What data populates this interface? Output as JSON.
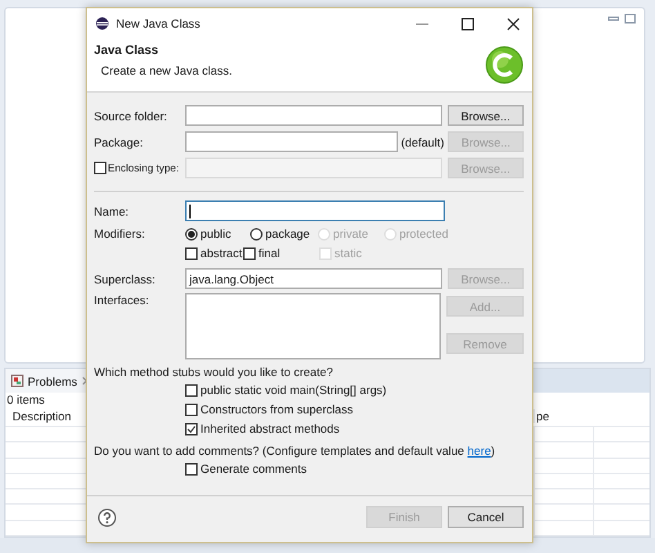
{
  "ide": {
    "problems": {
      "tab": "Problems",
      "status": "0 items",
      "columns": [
        "Description",
        "pe"
      ]
    }
  },
  "dialog": {
    "title": "New Java Class",
    "heading": "Java Class",
    "message": "Create a new Java class.",
    "location": [
      {
        "kind": "field",
        "label": "Source folder:",
        "button": {
          "label": "Browse...",
          "disabled": false
        }
      },
      {
        "kind": "suffixed",
        "label": "Package:",
        "suffix": "(default)",
        "button": {
          "label": "Browse...",
          "disabled": true
        }
      },
      {
        "kind": "checkfield",
        "label": "Enclosing type:",
        "checked": false,
        "disabled": true,
        "button": {
          "label": "Browse...",
          "disabled": true
        }
      }
    ],
    "name": {
      "label": "Name:",
      "focused": true
    },
    "modifiers": {
      "label": "Modifiers:",
      "radios": [
        {
          "label": "public",
          "selected": true,
          "disabled": false
        },
        {
          "label": "package",
          "selected": false,
          "disabled": false
        },
        {
          "label": "private",
          "selected": false,
          "disabled": true
        },
        {
          "label": "protected",
          "selected": false,
          "disabled": true
        }
      ],
      "checkboxes": [
        {
          "label": "abstract",
          "checked": false,
          "disabled": false
        },
        {
          "label": "final",
          "checked": false,
          "disabled": false
        },
        {
          "label": "static",
          "checked": false,
          "disabled": true
        }
      ]
    },
    "superclass": {
      "label": "Superclass:",
      "value": "java.lang.Object",
      "button": {
        "label": "Browse...",
        "disabled": true
      }
    },
    "interfaces": {
      "label": "Interfaces:",
      "buttons": [
        {
          "label": "Add...",
          "disabled": true
        },
        {
          "label": "Remove",
          "disabled": true
        }
      ]
    },
    "stubs": {
      "question": "Which method stubs would you like to create?",
      "options": [
        {
          "label": "public static void main(String[] args)",
          "checked": false
        },
        {
          "label": "Constructors from superclass",
          "checked": false
        },
        {
          "label": "Inherited abstract methods",
          "checked": true
        }
      ]
    },
    "comments": {
      "question": "Do you want to add comments? (Configure templates and default value",
      "link": "here",
      "closing": ")",
      "options": [
        {
          "label": "Generate comments",
          "checked": false
        }
      ]
    },
    "buttons": [
      {
        "label": "Finish",
        "disabled": true
      },
      {
        "label": "Cancel",
        "disabled": false
      }
    ]
  }
}
